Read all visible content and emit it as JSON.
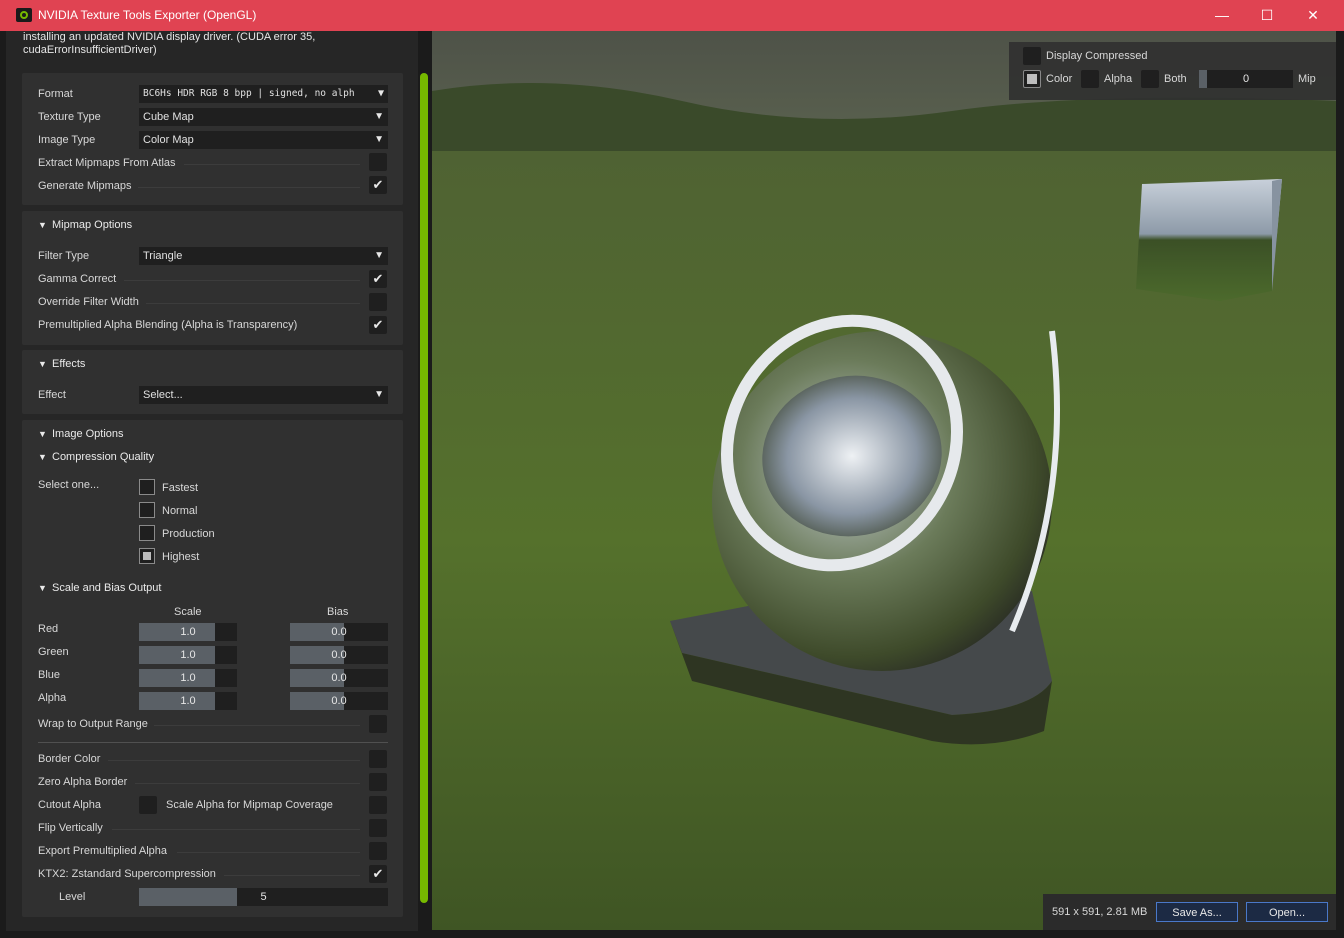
{
  "window": {
    "title": "NVIDIA Texture Tools Exporter (OpenGL)",
    "minimize": "—",
    "maximize": "☐",
    "close": "✕"
  },
  "message": "installing an updated NVIDIA display driver. (CUDA error 35, cudaErrorInsufficientDriver)",
  "format_panel": {
    "format_label": "Format",
    "format_value": "BC6Hs HDR RGB   8 bpp | signed, no alph",
    "texture_type_label": "Texture Type",
    "texture_type_value": "Cube Map",
    "image_type_label": "Image Type",
    "image_type_value": "Color Map",
    "extract_label": "Extract Mipmaps From Atlas",
    "extract_checked": false,
    "generate_label": "Generate Mipmaps",
    "generate_checked": true
  },
  "mipmap": {
    "header": "Mipmap Options",
    "filter_label": "Filter Type",
    "filter_value": "Triangle",
    "gamma_label": "Gamma Correct",
    "gamma_checked": true,
    "override_label": "Override Filter Width",
    "override_checked": false,
    "premult_label": "Premultiplied Alpha Blending (Alpha is Transparency)",
    "premult_checked": true
  },
  "effects": {
    "header": "Effects",
    "effect_label": "Effect",
    "effect_value": "Select..."
  },
  "image_options": {
    "header": "Image Options",
    "quality_header": "Compression Quality",
    "select_one": "Select one...",
    "options": [
      "Fastest",
      "Normal",
      "Production",
      "Highest"
    ],
    "selected": "Highest",
    "scale_bias_header": "Scale and Bias Output",
    "scale_col": "Scale",
    "bias_col": "Bias",
    "channels": [
      {
        "name": "Red",
        "scale": "1.0",
        "bias": "0.0"
      },
      {
        "name": "Green",
        "scale": "1.0",
        "bias": "0.0"
      },
      {
        "name": "Blue",
        "scale": "1.0",
        "bias": "0.0"
      },
      {
        "name": "Alpha",
        "scale": "1.0",
        "bias": "0.0"
      }
    ],
    "wrap_label": "Wrap to Output Range",
    "border_color_label": "Border Color",
    "zero_alpha_label": "Zero Alpha Border",
    "cutout_label": "Cutout Alpha",
    "scale_alpha_label": "Scale Alpha for Mipmap Coverage",
    "flip_label": "Flip Vertically",
    "export_premult_label": "Export Premultiplied Alpha",
    "ktx2_label": "KTX2: Zstandard Supercompression",
    "ktx2_checked": true,
    "level_label": "Level",
    "level_value": "5"
  },
  "view_controls": {
    "display_compressed": "Display Compressed",
    "color": "Color",
    "alpha": "Alpha",
    "both": "Both",
    "mip_value": "0",
    "mip_label": "Mip"
  },
  "status": {
    "info": "591 x 591, 2.81 MB",
    "save_as": "Save As...",
    "open": "Open..."
  },
  "colors": {
    "titlebar": "#e04352",
    "accent": "#76b900",
    "button_border": "#4a78c8"
  }
}
